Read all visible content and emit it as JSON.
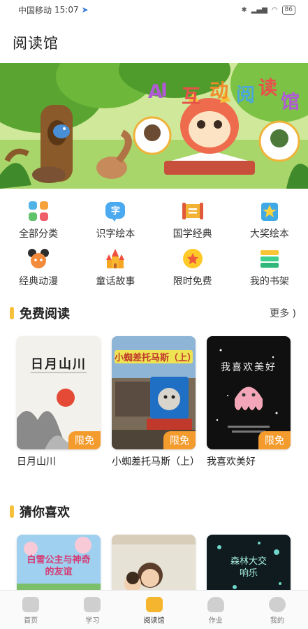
{
  "status_bar": {
    "carrier": "中国移动",
    "time": "15:07",
    "battery": "86"
  },
  "header": {
    "title": "阅读馆"
  },
  "banner": {
    "headline": [
      "A",
      "I",
      "互",
      "动",
      "阅",
      "读",
      "馆"
    ]
  },
  "categories": [
    {
      "label": "全部分类",
      "icon": "grid-icon"
    },
    {
      "label": "识字绘本",
      "icon": "character-bubble-icon",
      "glyph": "字"
    },
    {
      "label": "国学经典",
      "icon": "scroll-icon"
    },
    {
      "label": "大奖绘本",
      "icon": "award-book-icon"
    },
    {
      "label": "经典动漫",
      "icon": "mouse-ears-icon"
    },
    {
      "label": "童话故事",
      "icon": "castle-icon"
    },
    {
      "label": "限时免费",
      "icon": "star-coin-icon"
    },
    {
      "label": "我的书架",
      "icon": "bookshelf-icon"
    }
  ],
  "free_section": {
    "title": "免费阅读",
    "more": "更多 )",
    "books": [
      {
        "title": "日月山川",
        "tag": "限免",
        "cover_text": "日月山川"
      },
      {
        "title": "小蜘差托马斯（上）",
        "tag": "限免",
        "cover_text": "小蜘差托马斯（上）"
      },
      {
        "title": "我喜欢美好",
        "tag": "限免",
        "cover_text": "我喜欢美好"
      }
    ]
  },
  "guess_section": {
    "title": "猜你喜欢",
    "books": [
      {
        "cover_text": "白雪公主与神奇的友谊"
      },
      {
        "cover_text": ""
      },
      {
        "cover_text": "森林大交响乐"
      }
    ]
  },
  "tabbar": [
    {
      "label": "首页",
      "icon": "home-icon",
      "active": false
    },
    {
      "label": "学习",
      "icon": "study-icon",
      "active": false
    },
    {
      "label": "阅读馆",
      "icon": "reading-icon",
      "active": true
    },
    {
      "label": "作业",
      "icon": "homework-icon",
      "active": false
    },
    {
      "label": "我的",
      "icon": "profile-icon",
      "active": false
    }
  ],
  "colors": {
    "accent": "#f5c13a",
    "tag": "#f39b2d",
    "active_tab": "#f5b52e"
  }
}
